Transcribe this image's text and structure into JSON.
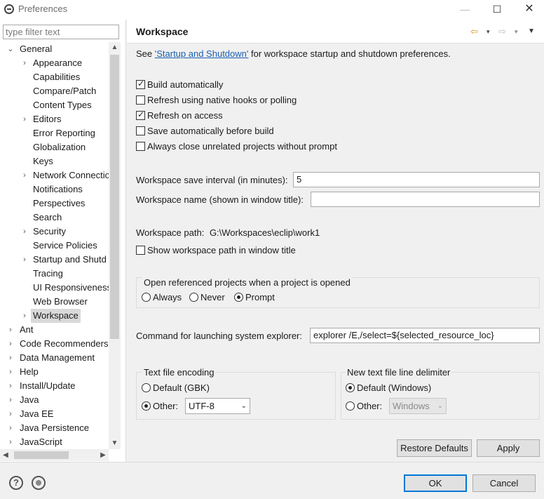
{
  "window": {
    "title": "Preferences",
    "minimize_glyph": "—",
    "maximize_glyph": "☐",
    "close_glyph": "✕"
  },
  "filter": {
    "placeholder": "type filter text"
  },
  "tree": {
    "items": [
      {
        "label": "General",
        "expanded": true,
        "level": 0
      },
      {
        "label": "Appearance",
        "level": 1,
        "has_children": true
      },
      {
        "label": "Capabilities",
        "level": 1
      },
      {
        "label": "Compare/Patch",
        "level": 1
      },
      {
        "label": "Content Types",
        "level": 1
      },
      {
        "label": "Editors",
        "level": 1,
        "has_children": true
      },
      {
        "label": "Error Reporting",
        "level": 1
      },
      {
        "label": "Globalization",
        "level": 1
      },
      {
        "label": "Keys",
        "level": 1
      },
      {
        "label": "Network Connectio",
        "level": 1,
        "has_children": true
      },
      {
        "label": "Notifications",
        "level": 1
      },
      {
        "label": "Perspectives",
        "level": 1
      },
      {
        "label": "Search",
        "level": 1
      },
      {
        "label": "Security",
        "level": 1,
        "has_children": true
      },
      {
        "label": "Service Policies",
        "level": 1
      },
      {
        "label": "Startup and Shutd",
        "level": 1,
        "has_children": true
      },
      {
        "label": "Tracing",
        "level": 1
      },
      {
        "label": "UI Responsiveness",
        "level": 1
      },
      {
        "label": "Web Browser",
        "level": 1
      },
      {
        "label": "Workspace",
        "level": 1,
        "has_children": true,
        "selected": true
      },
      {
        "label": "Ant",
        "level": 0,
        "has_children": true
      },
      {
        "label": "Code Recommenders",
        "level": 0,
        "has_children": true
      },
      {
        "label": "Data Management",
        "level": 0,
        "has_children": true
      },
      {
        "label": "Help",
        "level": 0,
        "has_children": true
      },
      {
        "label": "Install/Update",
        "level": 0,
        "has_children": true
      },
      {
        "label": "Java",
        "level": 0,
        "has_children": true
      },
      {
        "label": "Java EE",
        "level": 0,
        "has_children": true
      },
      {
        "label": "Java Persistence",
        "level": 0,
        "has_children": true
      },
      {
        "label": "JavaScript",
        "level": 0,
        "has_children": true
      }
    ]
  },
  "page": {
    "title": "Workspace",
    "intro_prefix": "See ",
    "intro_link": "'Startup and Shutdown'",
    "intro_suffix": " for workspace startup and shutdown preferences.",
    "checkboxes": {
      "build_auto": {
        "label": "Build automatically",
        "checked": true
      },
      "refresh_native": {
        "label": "Refresh using native hooks or polling",
        "checked": false
      },
      "refresh_access": {
        "label": "Refresh on access",
        "checked": true
      },
      "save_before_build": {
        "label": "Save automatically before build",
        "checked": false
      },
      "close_unrelated": {
        "label": "Always close unrelated projects without prompt",
        "checked": false
      }
    },
    "save_interval": {
      "label": "Workspace save interval (in minutes):",
      "value": "5"
    },
    "ws_name": {
      "label": "Workspace name (shown in window title):",
      "value": ""
    },
    "ws_path": {
      "label": "Workspace path:",
      "value": "G:\\Workspaces\\eclip\\work1"
    },
    "show_path": {
      "label": "Show workspace path in window title",
      "checked": false
    },
    "open_ref": {
      "title": "Open referenced projects when a project is opened",
      "options": [
        "Always",
        "Never",
        "Prompt"
      ],
      "selected": "Prompt"
    },
    "explorer": {
      "label": "Command for launching system explorer:",
      "value": "explorer /E,/select=${selected_resource_loc}"
    },
    "encoding": {
      "title": "Text file encoding",
      "default_label": "Default (GBK)",
      "other_label": "Other:",
      "selected": "Other",
      "other_value": "UTF-8"
    },
    "delimiter": {
      "title": "New text file line delimiter",
      "default_label": "Default (Windows)",
      "other_label": "Other:",
      "selected": "Default",
      "other_value": "Windows"
    },
    "restore_defaults_label": "Restore Defaults",
    "apply_label": "Apply"
  },
  "footer": {
    "ok_label": "OK",
    "cancel_label": "Cancel",
    "help_glyph": "?"
  },
  "icons": {
    "back": "⇦",
    "forward": "⇨",
    "dropdown": "▾",
    "menu": "▼",
    "expanded": "⌄",
    "collapsed": "›",
    "scroll_up": "▲",
    "scroll_down": "▼",
    "scroll_left": "◀",
    "scroll_right": "▶"
  }
}
